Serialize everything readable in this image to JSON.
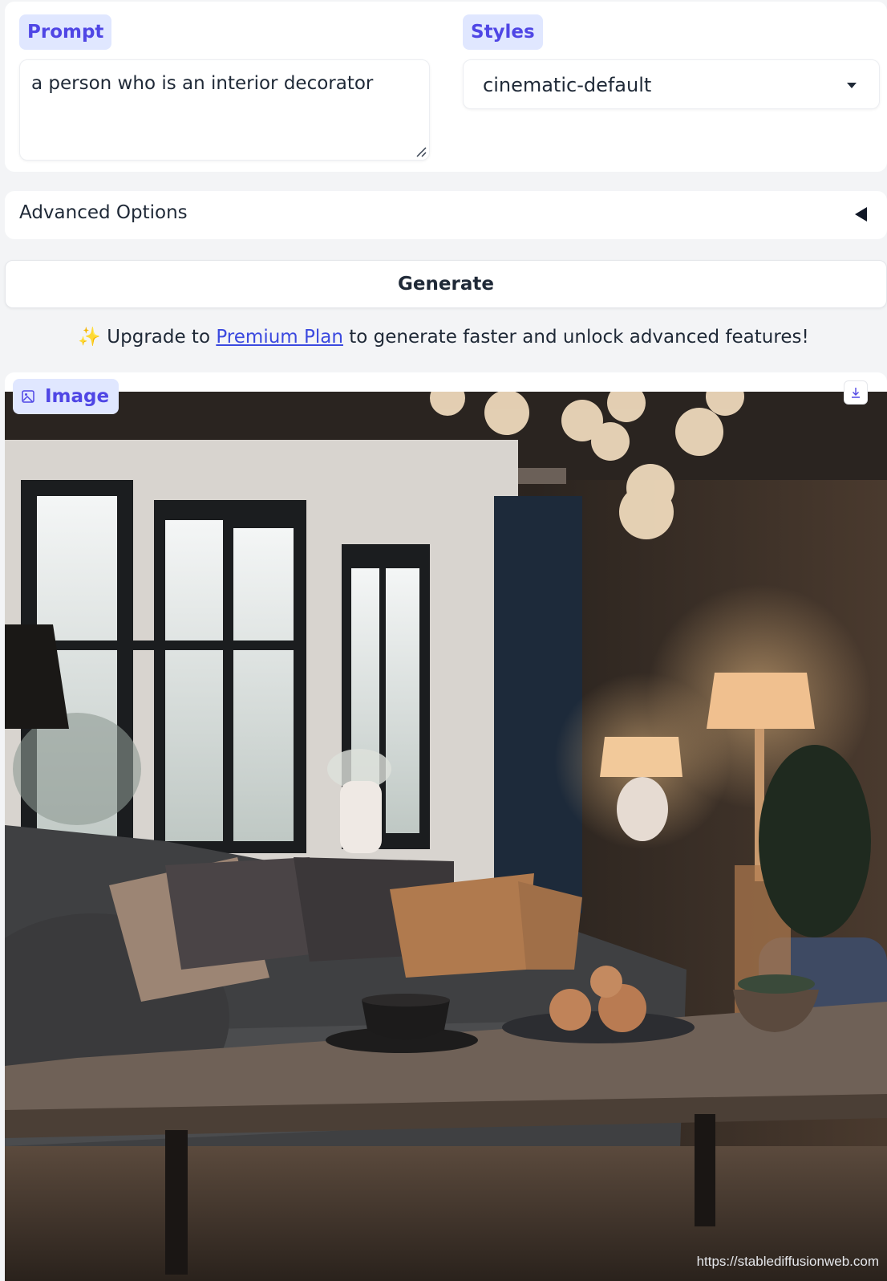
{
  "prompt": {
    "label": "Prompt",
    "value": "a person who is an interior decorator"
  },
  "styles": {
    "label": "Styles",
    "selected": "cinematic-default"
  },
  "advanced": {
    "label": "Advanced Options"
  },
  "generate": {
    "label": "Generate"
  },
  "upgrade": {
    "sparkle": "✨",
    "before": "Upgrade to",
    "link": "Premium Plan",
    "after": "to generate faster and unlock advanced features!"
  },
  "image": {
    "label": "Image",
    "watermark": "https://stablediffusionweb.com"
  },
  "colors": {
    "accent": "#4f46e5",
    "badge_bg": "#e0e7ff",
    "link": "#3b49df"
  }
}
